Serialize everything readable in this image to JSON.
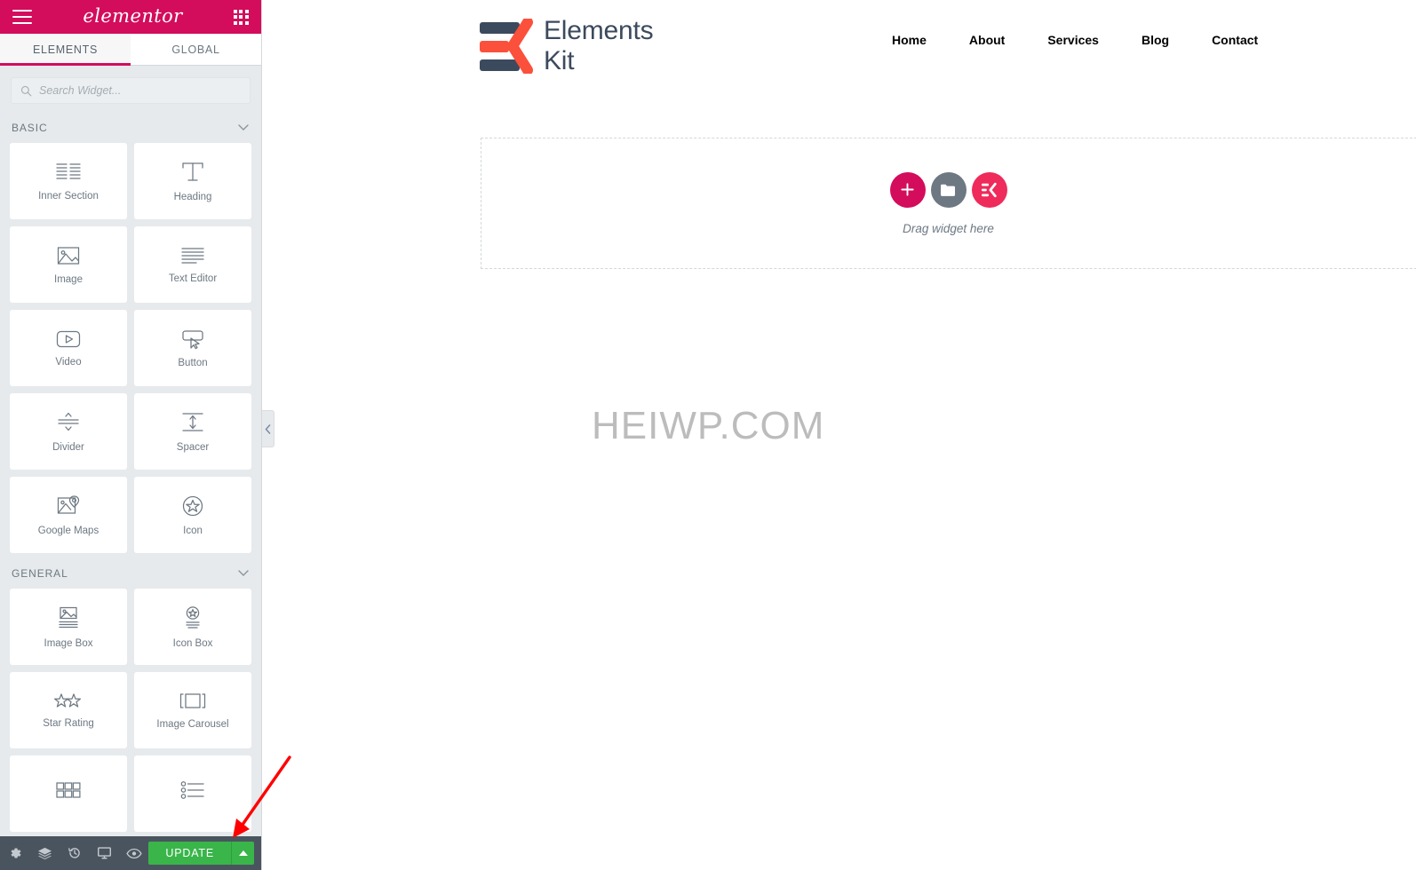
{
  "panel": {
    "brand": "elementor",
    "menu_icon": "hamburger-icon",
    "apps_icon": "grid-apps-icon",
    "tabs": [
      {
        "label": "ELEMENTS",
        "active": true
      },
      {
        "label": "GLOBAL",
        "active": false
      }
    ],
    "search": {
      "placeholder": "Search Widget...",
      "value": ""
    },
    "categories": [
      {
        "title": "BASIC",
        "collapsed": false,
        "widgets": [
          {
            "label": "Inner Section",
            "icon": "inner-section-icon"
          },
          {
            "label": "Heading",
            "icon": "heading-icon"
          },
          {
            "label": "Image",
            "icon": "image-icon"
          },
          {
            "label": "Text Editor",
            "icon": "text-editor-icon"
          },
          {
            "label": "Video",
            "icon": "video-icon"
          },
          {
            "label": "Button",
            "icon": "button-icon"
          },
          {
            "label": "Divider",
            "icon": "divider-icon"
          },
          {
            "label": "Spacer",
            "icon": "spacer-icon"
          },
          {
            "label": "Google Maps",
            "icon": "google-maps-icon"
          },
          {
            "label": "Icon",
            "icon": "star-icon"
          }
        ]
      },
      {
        "title": "GENERAL",
        "collapsed": false,
        "widgets": [
          {
            "label": "Image Box",
            "icon": "image-box-icon"
          },
          {
            "label": "Icon Box",
            "icon": "icon-box-icon"
          },
          {
            "label": "Star Rating",
            "icon": "star-rating-icon"
          },
          {
            "label": "Image Carousel",
            "icon": "image-carousel-icon"
          },
          {
            "label": "",
            "icon": "image-gallery-icon"
          },
          {
            "label": "",
            "icon": "icon-list-icon"
          }
        ]
      }
    ],
    "collapse_tab_icon": "chevron-left-icon"
  },
  "bottom_bar": {
    "icons": [
      {
        "name": "settings-gear-icon"
      },
      {
        "name": "navigator-layers-icon"
      },
      {
        "name": "history-icon"
      },
      {
        "name": "responsive-mode-icon"
      },
      {
        "name": "preview-eye-icon"
      }
    ],
    "update_label": "UPDATE",
    "update_caret_icon": "caret-up-icon",
    "update_color": "#39b54a"
  },
  "canvas": {
    "site_logo": {
      "line1": "Elements",
      "line2": "Kit",
      "mark": "elementskit-logo-icon"
    },
    "nav": [
      {
        "label": "Home"
      },
      {
        "label": "About"
      },
      {
        "label": "Services"
      },
      {
        "label": "Blog"
      },
      {
        "label": "Contact"
      }
    ],
    "drop_zone": {
      "label": "Drag widget here",
      "buttons": [
        {
          "name": "add-section-button",
          "icon": "plus-icon",
          "color": "#d30c5c"
        },
        {
          "name": "template-library-button",
          "icon": "folder-icon",
          "color": "#6d7882"
        },
        {
          "name": "elementskit-library-button",
          "icon": "ek-icon",
          "color": "#ee2b5b"
        }
      ]
    },
    "watermark": "HEIWP.COM"
  },
  "annotation": {
    "arrow_color": "#ff0000",
    "points_to": "UPDATE"
  },
  "colors": {
    "accent_pink": "#d30c5c",
    "panel_bg": "#e6eaec",
    "bottom_bar": "#4a545e",
    "logo_dark": "#3c4a5d",
    "logo_coral": "#fb503b"
  }
}
